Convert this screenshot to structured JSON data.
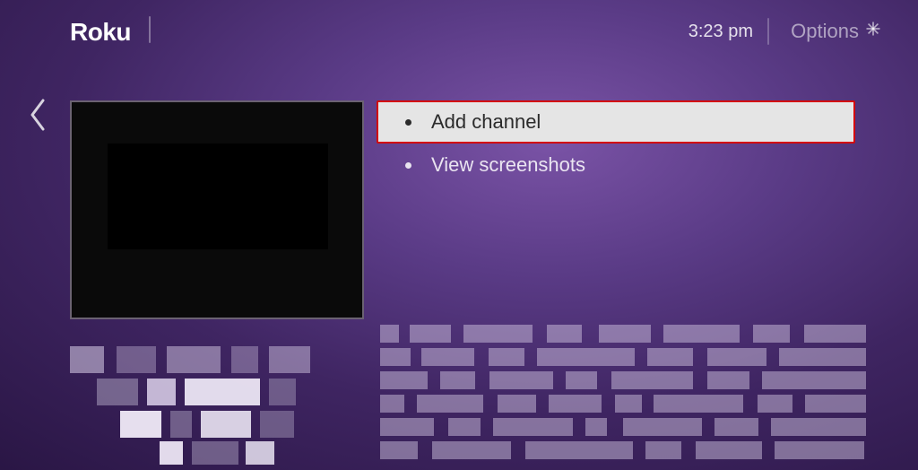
{
  "header": {
    "logo": "Roku",
    "time": "3:23 pm",
    "options_label": "Options"
  },
  "menu": {
    "items": [
      {
        "label": "Add channel",
        "focused": true
      },
      {
        "label": "View screenshots",
        "focused": false
      }
    ]
  }
}
